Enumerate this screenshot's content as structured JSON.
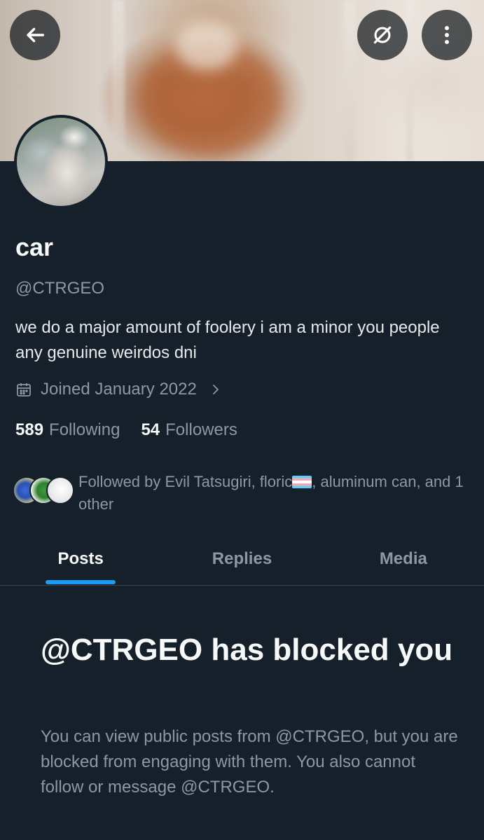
{
  "header": {
    "back_icon": "arrow-left-icon",
    "action_icon": "slashed-circle-icon",
    "more_icon": "vertical-dots-icon"
  },
  "profile": {
    "name": "car",
    "handle": "@CTRGEO",
    "bio": "we do a major amount of foolery i am a minor you people any genuine weirdos dni",
    "joined": "Joined January 2022",
    "following_count": "589",
    "following_label": "Following",
    "followers_count": "54",
    "followers_label": "Followers",
    "followed_by_prefix": "Followed by Evil Tatsugiri, floric",
    "followed_by_suffix": ", aluminum can, and 1 other"
  },
  "tabs": [
    {
      "label": "Posts",
      "active": true
    },
    {
      "label": "Replies",
      "active": false
    },
    {
      "label": "Media",
      "active": false
    }
  ],
  "blocked": {
    "title": "@CTRGEO has blocked you",
    "description": "You can view public posts from @CTRGEO, but you are blocked from engaging with them. You also cannot follow or message @CTRGEO."
  },
  "colors": {
    "background": "#15202b",
    "accent": "#1d9bf0",
    "muted_text": "#8b98a5"
  }
}
